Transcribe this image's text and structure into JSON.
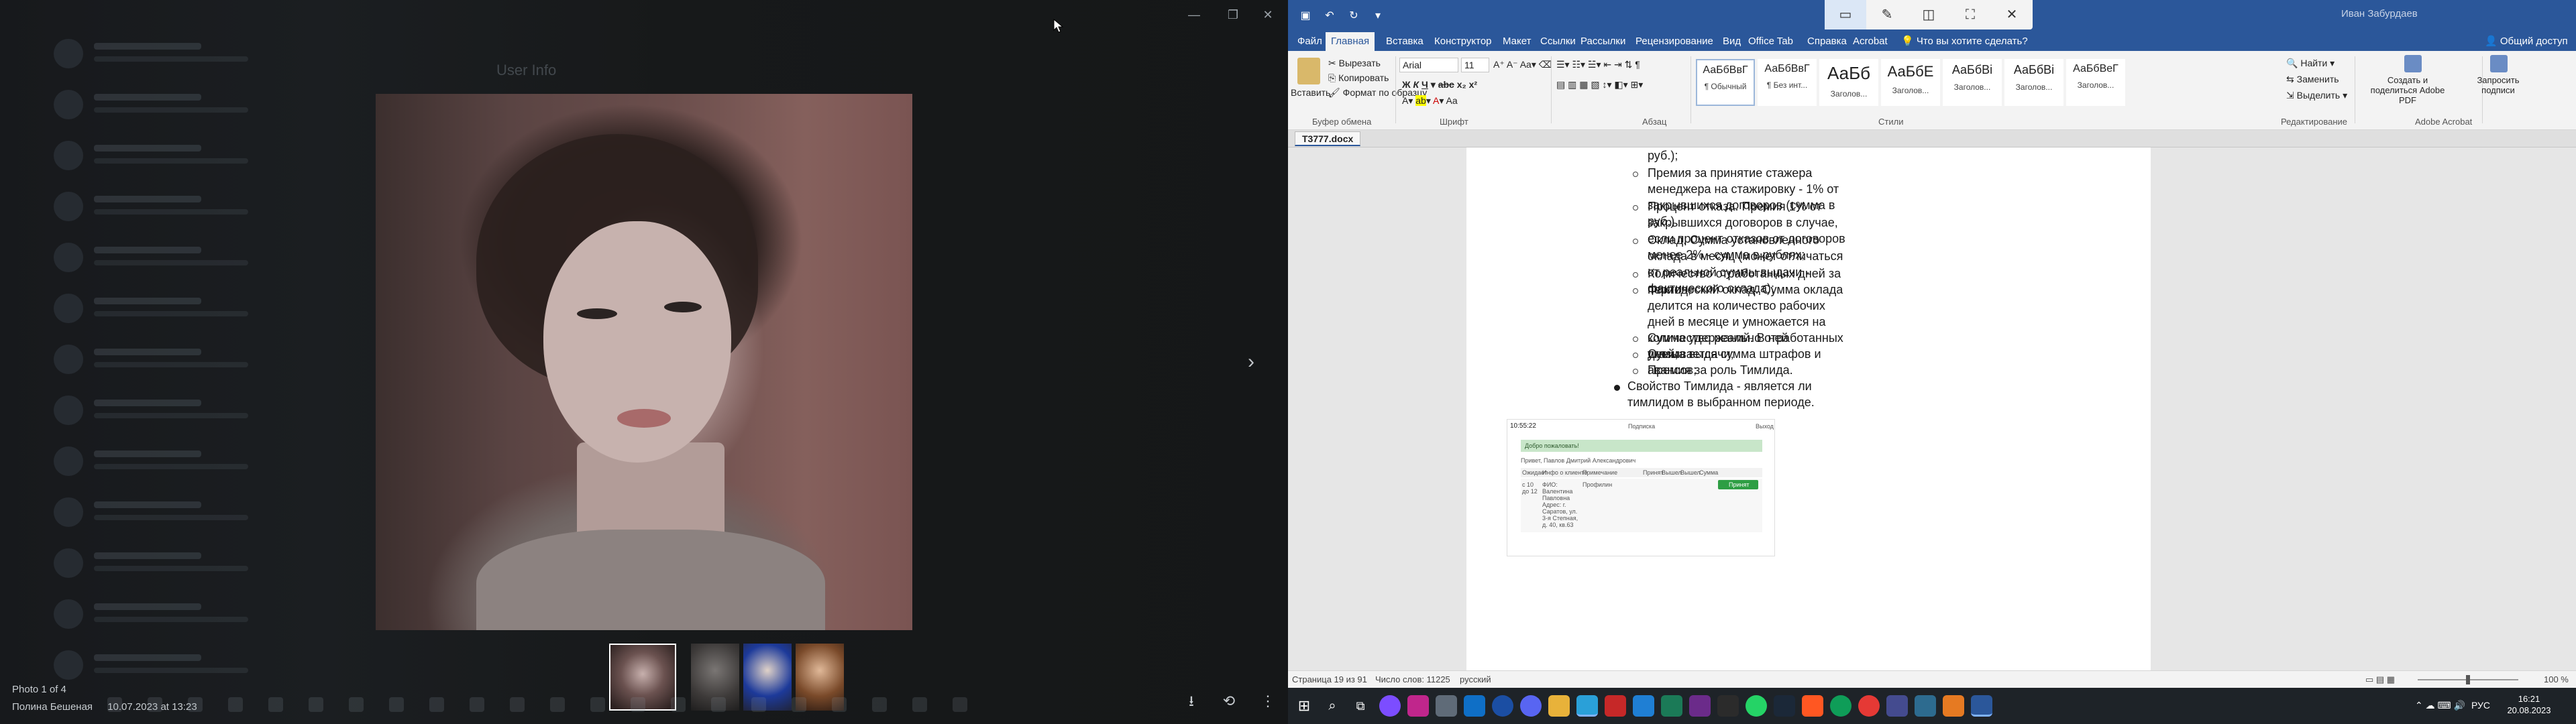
{
  "viewer": {
    "caption_count": "Photo 1 of 4",
    "caption_author": "Полина Бешеная",
    "caption_date": "10.07.2023 at 13:23",
    "bg_user_info": "User Info",
    "win_minimize": "—",
    "win_maximize": "❐",
    "win_close": "✕",
    "next_glyph": "›",
    "download_glyph": "⭳",
    "rotate_glyph": "⟲",
    "more_glyph": "⋮"
  },
  "word": {
    "title_user": "Иван Забурдаев",
    "tabs": [
      "Файл",
      "Главная",
      "Вставка",
      "Конструктор",
      "Макет",
      "Ссылки",
      "Рассылки",
      "Рецензирование",
      "Вид",
      "Office Tab",
      "Справка",
      "Acrobat",
      "Что вы хотите сделать?",
      "Общий доступ"
    ],
    "clipboard": {
      "paste": "Вставить",
      "cut": "Вырезать",
      "copy": "Копировать",
      "format_painter": "Формат по образцу",
      "group": "Буфер обмена"
    },
    "font": {
      "name": "Arial",
      "size": "11",
      "group": "Шрифт"
    },
    "paragraph_group": "Абзац",
    "styles_group": "Стили",
    "styles": [
      {
        "preview": "АаБбВвГ",
        "name": "¶ Обычный"
      },
      {
        "preview": "АаБбВвГ",
        "name": "¶ Без инт..."
      },
      {
        "preview": "АаБб",
        "name": "Заголов..."
      },
      {
        "preview": "АаБбЕ",
        "name": "Заголов..."
      },
      {
        "preview": "АаБбВі",
        "name": "Заголов..."
      },
      {
        "preview": "АаБбВі",
        "name": "Заголов..."
      },
      {
        "preview": "АаБбВеГ",
        "name": "Заголов..."
      }
    ],
    "editing": {
      "find": "Найти",
      "replace": "Заменить",
      "select": "Выделить",
      "group": "Редактирование"
    },
    "acrobat": {
      "create": "Создать и поделиться Adobe PDF",
      "request": "Запросить подписи",
      "group": "Adobe Acrobat"
    },
    "doc_tab": "Т3777.docx",
    "body": {
      "line0": "руб.);",
      "items": [
        "Премия за принятие стажера менеджера на стажировку - 1% от закрывшихся договоров (сумма в руб.)",
        "Процент отказа. Премия 1% от закрывшихся договоров в случае, если процент отказов от договоров менее 2% - сумма в рублях;",
        "Оклад. Сумма установленного оклада в месяц (может отличаться от реальной суммы выдачи - фактического оклада);",
        "Количество отработанных дней за период;",
        "Фактический оклад. Сумма оклада делится на количество рабочих дней в месяце и умножается на количество реально отработанных дней;",
        "Сумма удержаний. В ней указывается сумма штрафов и авансов;",
        "Сумма выдачи;",
        "Премия за роль Тимлида."
      ],
      "bullet": "Свойство Тимлида - является ли тимлидом в выбранном периоде."
    },
    "embed": {
      "time": "10:55:22",
      "center": "Подписка",
      "right": "Выход",
      "welcome": "Добро пожаловать!",
      "user": "Привет, Павлов Дмитрий Александрович",
      "headers": [
        "Ожидает",
        "Инфо о клиенте",
        "Примечание",
        "Принят",
        "Вышел",
        "Вышел",
        "Сумма"
      ],
      "row_wait": "с 10 до 12",
      "row_fio": "ФИО: Валентина Павловна",
      "row_addr": "Адрес: г. Саратов, ул. 3-я Степная, д. 40, кв.63",
      "row_note": "Профилин",
      "accept": "Принят"
    },
    "status": {
      "page": "Страница 19 из 91",
      "words": "Число слов: 11225",
      "lang": "русский",
      "zoom": "100 %"
    }
  },
  "taskbar": {
    "lang": "РУС",
    "time": "16:21",
    "date": "20.08.2023"
  }
}
